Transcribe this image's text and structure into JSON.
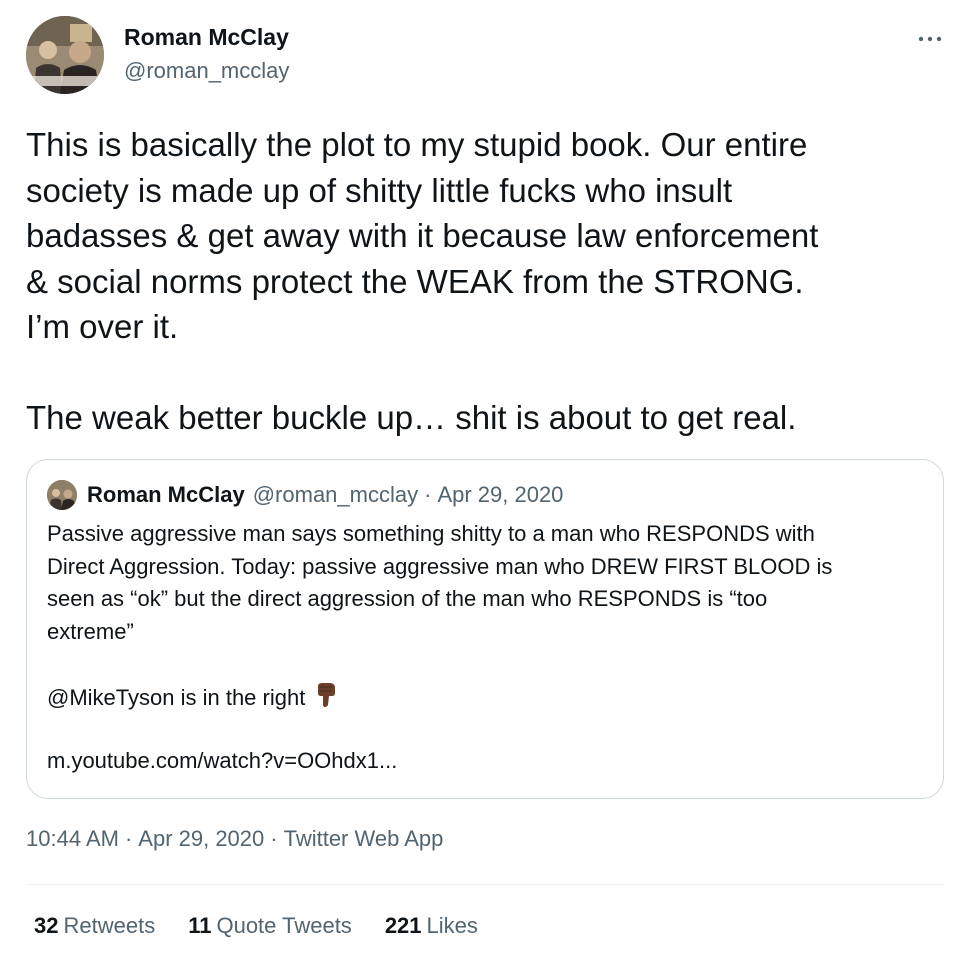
{
  "tweet": {
    "author_name": "Roman McClay",
    "author_handle": "@roman_mcclay",
    "more_icon": "more-horizontal-icon",
    "text": "This is basically the plot to my stupid book. Our entire\nsociety is made up of shitty little fucks who insult\nbadasses & get away with it because law enforcement\n& social norms protect the WEAK from the STRONG.\nI’m over it.\n\nThe weak better buckle up… shit is about to get real.",
    "time": "10:44 AM",
    "date": "Apr 29, 2020",
    "separator": "·",
    "source": "Twitter Web App"
  },
  "quote": {
    "author_name": "Roman McClay",
    "author_handle": "@roman_mcclay",
    "separator": "·",
    "date": "Apr 29, 2020",
    "text": "Passive aggressive man says something shitty to a man who RESPONDS with\nDirect Aggression. Today: passive aggressive man who DREW FIRST BLOOD is\nseen as “ok” but the direct aggression of the man who RESPONDS is “too\nextreme”",
    "mention_line": "@MikeTyson is in the right",
    "emoji": "backhand-index-pointing-down-icon",
    "link": "m.youtube.com/watch?v=OOhdx1..."
  },
  "stats": {
    "retweets_count": "32",
    "retweets_label": "Retweets",
    "quotes_count": "11",
    "quotes_label": "Quote Tweets",
    "likes_count": "221",
    "likes_label": "Likes"
  },
  "colors": {
    "primary_text": "#0f1419",
    "secondary_text": "#536471",
    "border": "#cfd9de"
  }
}
